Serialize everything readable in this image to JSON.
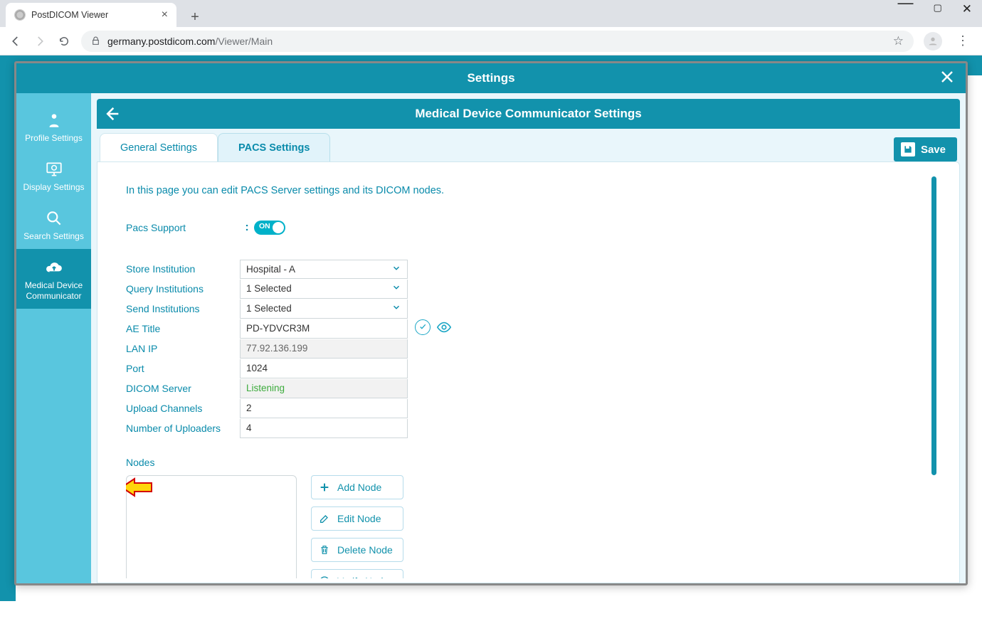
{
  "browser": {
    "tab_title": "PostDICOM Viewer",
    "url_domain": "germany.postdicom.com",
    "url_path": "/Viewer/Main"
  },
  "modal": {
    "title": "Settings",
    "subtitle": "Medical Device Communicator Settings",
    "save_label": "Save"
  },
  "leftnav": {
    "profile": "Profile Settings",
    "display": "Display Settings",
    "search": "Search Settings",
    "mdc": "Medical Device Communicator"
  },
  "tabs": {
    "general": "General Settings",
    "pacs": "PACS Settings"
  },
  "page": {
    "intro": "In this page you can edit PACS Server settings and its DICOM nodes.",
    "pacs_support_label": "Pacs Support",
    "toggle_on": "ON",
    "store_institution_label": "Store Institution",
    "store_institution_value": "Hospital - A",
    "query_institutions_label": "Query Institutions",
    "query_institutions_value": "1 Selected",
    "send_institutions_label": "Send Institutions",
    "send_institutions_value": "1 Selected",
    "ae_title_label": "AE Title",
    "ae_title_value": "PD-YDVCR3M",
    "lan_ip_label": "LAN IP",
    "lan_ip_value": "77.92.136.199",
    "port_label": "Port",
    "port_value": "1024",
    "dicom_server_label": "DICOM Server",
    "dicom_server_value": "Listening",
    "upload_channels_label": "Upload Channels",
    "upload_channels_value": "2",
    "num_uploaders_label": "Number of Uploaders",
    "num_uploaders_value": "4",
    "nodes_label": "Nodes",
    "add_node": "Add Node",
    "edit_node": "Edit Node",
    "delete_node": "Delete Node",
    "verify_node": "Verify Node"
  }
}
